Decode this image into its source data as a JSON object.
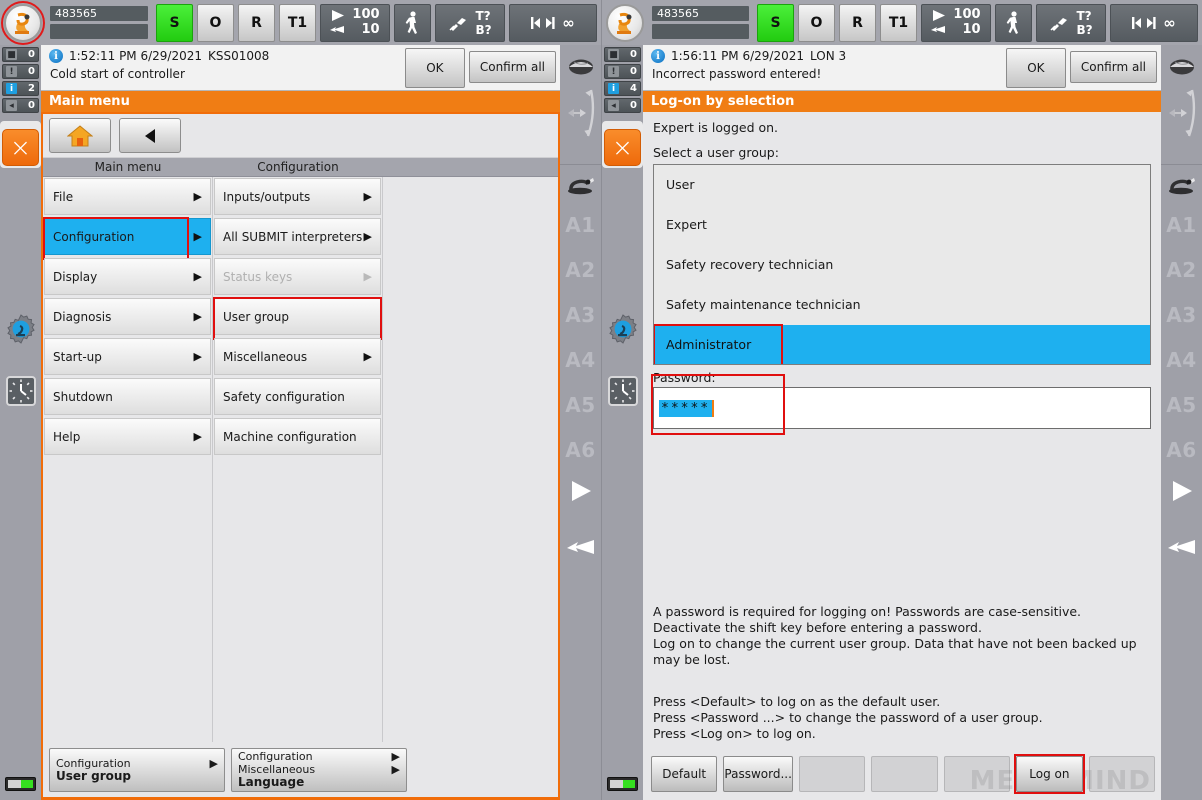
{
  "status_bar": {
    "robot_icon": "robot-arm-icon",
    "program_name": "483565",
    "program_name_secondary": "",
    "submit_label": "S",
    "drives_label": "O",
    "robot_interpreter_label": "R",
    "mode_label": "T1",
    "program_override": "100",
    "jog_override": "10",
    "jog_mode_icon": "walking-person-icon",
    "tool_base_tool": "T?",
    "tool_base_base": "B?",
    "increment_icon": "increment-jogging-icon",
    "increment_value": "∞",
    "green_color": "#29d413",
    "accent_color": "#f07d14",
    "highlight_color": "#1eb0ef",
    "redbox_color": "#e00f0f"
  },
  "left_pane": {
    "counters": [
      {
        "icon": "error-badge-icon",
        "value": "0"
      },
      {
        "icon": "warning-badge-icon",
        "value": "0"
      },
      {
        "icon": "info-badge-icon",
        "value": "2"
      },
      {
        "icon": "acknowledge-badge-icon",
        "value": "0"
      }
    ],
    "close_button": "×",
    "message": {
      "icon": "info-circle-icon",
      "timestamp": "1:52:11 PM 6/29/2021",
      "code": "KSS01008",
      "text": "Cold start of controller",
      "ok_label": "OK",
      "confirm_all_label": "Confirm all"
    },
    "title": "Main menu",
    "toolbar": {
      "home_icon": "home-icon",
      "back_icon": "back-arrow-icon"
    },
    "columns": [
      {
        "header": "Main menu",
        "items": [
          {
            "label": "File",
            "arrow": true,
            "selected": false,
            "disabled": false,
            "highlight_box": false
          },
          {
            "label": "Configuration",
            "arrow": true,
            "selected": true,
            "disabled": false,
            "highlight_box": true
          },
          {
            "label": "Display",
            "arrow": true,
            "selected": false,
            "disabled": false,
            "highlight_box": false
          },
          {
            "label": "Diagnosis",
            "arrow": true,
            "selected": false,
            "disabled": false,
            "highlight_box": false
          },
          {
            "label": "Start-up",
            "arrow": true,
            "selected": false,
            "disabled": false,
            "highlight_box": false
          },
          {
            "label": "Shutdown",
            "arrow": false,
            "selected": false,
            "disabled": false,
            "highlight_box": false
          },
          {
            "label": "Help",
            "arrow": true,
            "selected": false,
            "disabled": false,
            "highlight_box": false
          }
        ]
      },
      {
        "header": "Configuration",
        "items": [
          {
            "label": "Inputs/outputs",
            "arrow": true,
            "selected": false,
            "disabled": false,
            "highlight_box": false
          },
          {
            "label": "All SUBMIT interpreters",
            "arrow": true,
            "selected": false,
            "disabled": false,
            "highlight_box": false
          },
          {
            "label": "Status keys",
            "arrow": true,
            "selected": false,
            "disabled": true,
            "highlight_box": false
          },
          {
            "label": "User group",
            "arrow": false,
            "selected": false,
            "disabled": false,
            "highlight_box": true
          },
          {
            "label": "Miscellaneous",
            "arrow": true,
            "selected": false,
            "disabled": false,
            "highlight_box": false
          },
          {
            "label": "Safety configuration",
            "arrow": false,
            "selected": false,
            "disabled": false,
            "highlight_box": false
          },
          {
            "label": "Machine configuration",
            "arrow": false,
            "selected": false,
            "disabled": false,
            "highlight_box": false
          }
        ]
      }
    ],
    "tabs": [
      {
        "lines": [
          "Configuration"
        ],
        "arrows": [
          true
        ],
        "bold_line": "User group"
      },
      {
        "lines": [
          "Configuration",
          "Miscellaneous"
        ],
        "arrows": [
          true,
          true
        ],
        "bold_line": "Language"
      }
    ]
  },
  "right_pane": {
    "counters": [
      {
        "icon": "error-badge-icon",
        "value": "0"
      },
      {
        "icon": "warning-badge-icon",
        "value": "0"
      },
      {
        "icon": "info-badge-icon",
        "value": "4"
      },
      {
        "icon": "acknowledge-badge-icon",
        "value": "0"
      }
    ],
    "close_button": "×",
    "message": {
      "icon": "info-circle-icon",
      "timestamp": "1:56:11 PM 6/29/2021",
      "code": "LON 3",
      "text": "Incorrect password entered!",
      "ok_label": "OK",
      "confirm_all_label": "Confirm all"
    },
    "title": "Log-on by selection",
    "logged_on_text": "Expert is logged on.",
    "select_label": "Select a user group:",
    "user_groups": [
      {
        "label": "User",
        "selected": false
      },
      {
        "label": "Expert",
        "selected": false
      },
      {
        "label": "Safety recovery technician",
        "selected": false
      },
      {
        "label": "Safety maintenance technician",
        "selected": false
      },
      {
        "label": "Administrator",
        "selected": true
      }
    ],
    "password_label": "Password:",
    "password_value": "*****",
    "help_text": "A password is required for logging on! Passwords are case-sensitive. Deactivate the shift key before entering a password.\nLog on to change the current user group. Data that have not been backed up may be lost.",
    "help_text_2": "Press <Default> to log on as the default user.\nPress <Password ...> to change the password of a user group.\nPress <Log on> to log on.",
    "buttons": [
      {
        "label": "Default",
        "empty": false,
        "highlight_box": false
      },
      {
        "label": "Password...",
        "empty": false,
        "highlight_box": false
      },
      {
        "label": "",
        "empty": true,
        "highlight_box": false
      },
      {
        "label": "",
        "empty": true,
        "highlight_box": false
      },
      {
        "label": "",
        "empty": true,
        "highlight_box": false
      },
      {
        "label": "Log on",
        "empty": false,
        "highlight_box": true
      },
      {
        "label": "",
        "empty": true,
        "highlight_box": false
      }
    ],
    "watermark": "MECH MIND"
  },
  "rail_right": {
    "globe_icon": "world-coordinates-icon",
    "move_icon": "axis-move-icon",
    "robot_icon": "robot-axis-icon",
    "axis_labels": [
      "A1",
      "A2",
      "A3",
      "A4",
      "A5",
      "A6"
    ],
    "play_icon": "play-icon",
    "hand_icon": "hand-jog-icon"
  }
}
